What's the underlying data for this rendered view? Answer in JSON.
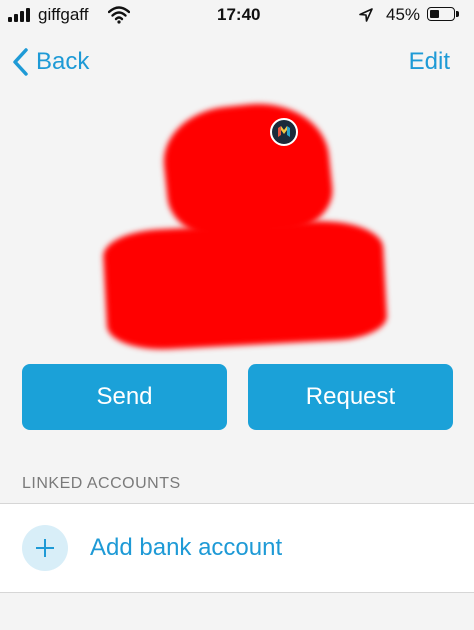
{
  "status_bar": {
    "carrier": "giffgaff",
    "time": "17:40",
    "battery_percent": "45%",
    "battery_level": 0.45
  },
  "nav": {
    "back_label": "Back",
    "edit_label": "Edit"
  },
  "actions": {
    "send_label": "Send",
    "request_label": "Request"
  },
  "linked_accounts": {
    "header": "LINKED ACCOUNTS",
    "add_label": "Add bank account"
  },
  "colors": {
    "accent": "#1ba1d8",
    "redaction": "#ff0000"
  },
  "icons": [
    "signal-bars-icon",
    "wifi-icon",
    "location-arrow-icon",
    "battery-icon",
    "chevron-left-icon",
    "monzo-badge-icon",
    "plus-icon"
  ]
}
